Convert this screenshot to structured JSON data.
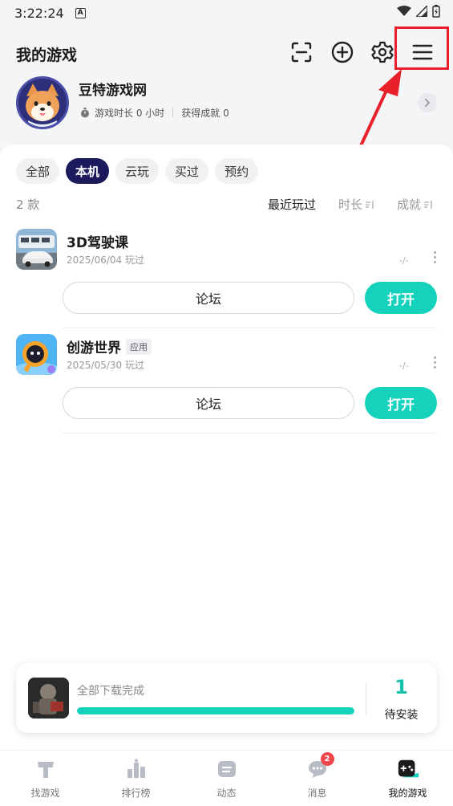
{
  "status_bar": {
    "time": "3:22:24",
    "notif_letter": "A"
  },
  "header": {
    "title": "我的游戏",
    "icons": [
      "scan-icon",
      "add-circle-icon",
      "gear-icon",
      "menu-icon"
    ],
    "highlight_color": "#e8202a"
  },
  "profile": {
    "name": "豆特游戏网",
    "playtime": "游戏时长 0 小时",
    "achievements": "获得成就 0"
  },
  "filters": {
    "tabs": [
      "全部",
      "本机",
      "云玩",
      "买过",
      "预约"
    ],
    "active_index": 1
  },
  "list_meta": {
    "count": "2 款",
    "sort_recent": "最近玩过",
    "sort_duration": "时长",
    "sort_achievement": "成就"
  },
  "games": [
    {
      "name": "3D驾驶课",
      "tag": "",
      "date": "2025/06/04 玩过",
      "dash": "-/-",
      "forum_label": "论坛",
      "open_label": "打开"
    },
    {
      "name": "创游世界",
      "tag": "应用",
      "date": "2025/05/30 玩过",
      "dash": "-/-",
      "forum_label": "论坛",
      "open_label": "打开"
    }
  ],
  "download": {
    "status": "全部下载完成",
    "progress": 1.0,
    "pending_count": "1",
    "pending_label": "待安装"
  },
  "bottom_nav": {
    "items": [
      {
        "label": "找游戏",
        "icon": "find-game-icon"
      },
      {
        "label": "排行榜",
        "icon": "ranking-icon"
      },
      {
        "label": "动态",
        "icon": "feed-icon"
      },
      {
        "label": "消息",
        "icon": "message-icon",
        "badge": "2"
      },
      {
        "label": "我的游戏",
        "icon": "gamepad-icon"
      }
    ],
    "active_index": 4
  },
  "colors": {
    "accent": "#15d2bd",
    "active_tab": "#1c1a5c",
    "badge": "#f0464a"
  }
}
